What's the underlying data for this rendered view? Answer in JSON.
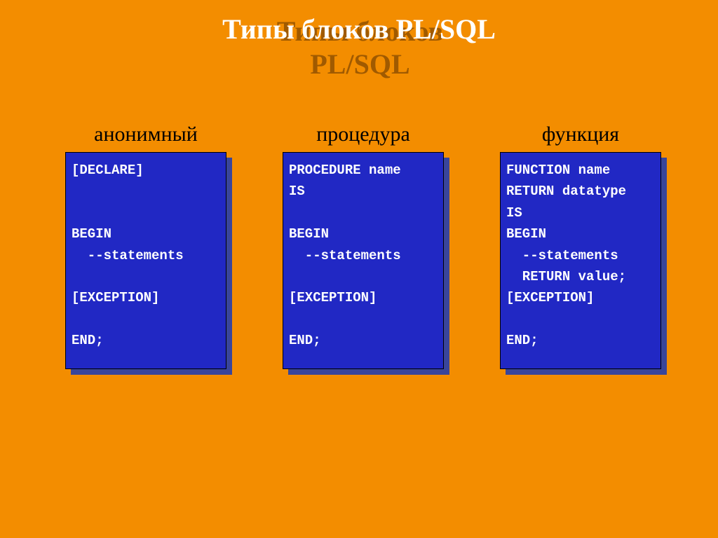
{
  "title": "Типы блоков PL/SQL",
  "columns": [
    {
      "label": "анонимный",
      "code": "[DECLARE]\n\n\nBEGIN\n  --statements\n\n[EXCEPTION]\n\nEND;"
    },
    {
      "label": "процедура",
      "code": "PROCEDURE name\nIS\n\nBEGIN\n  --statements\n\n[EXCEPTION]\n\nEND;"
    },
    {
      "label": "функция",
      "code": "FUNCTION name\nRETURN datatype\nIS\nBEGIN\n  --statements\n  RETURN value;\n[EXCEPTION]\n\nEND;"
    }
  ]
}
